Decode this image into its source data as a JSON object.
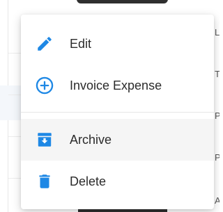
{
  "background": {
    "right_letters": [
      "L",
      "T",
      "P",
      "P",
      "A"
    ]
  },
  "menu": {
    "items": [
      {
        "label": "Edit",
        "icon": "pencil-icon"
      },
      {
        "label": "Invoice Expense",
        "icon": "plus-circle-icon"
      },
      {
        "label": "Archive",
        "icon": "archive-icon",
        "hovered": true
      },
      {
        "label": "Delete",
        "icon": "trash-icon"
      }
    ]
  },
  "colors": {
    "accent": "#1e88e5",
    "hover": "#f5f5f5",
    "text": "#2b2b2b"
  }
}
